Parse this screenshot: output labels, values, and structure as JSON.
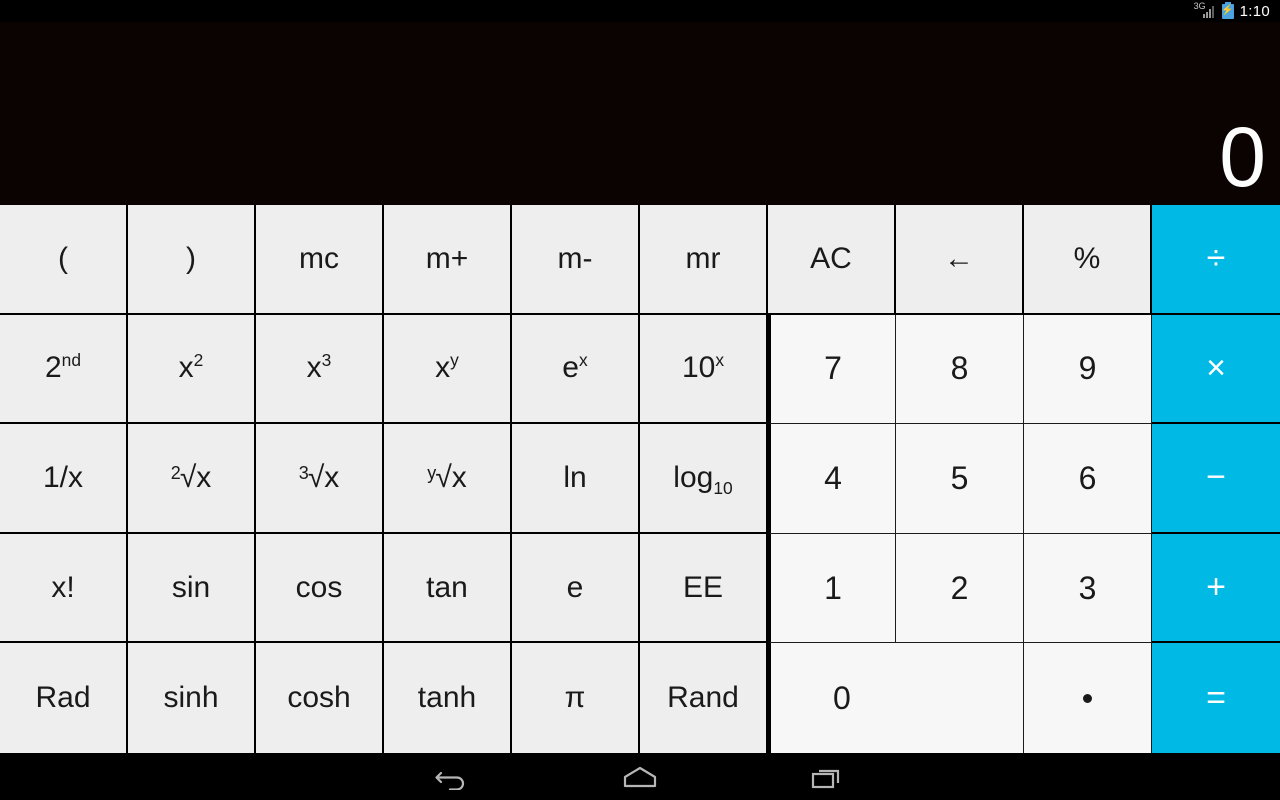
{
  "status_bar": {
    "network_label": "3G",
    "battery_icon": "battery-charging-icon",
    "signal_icon": "signal-bars-icon",
    "time": "1:10"
  },
  "display": {
    "value": "0"
  },
  "keypad": {
    "rows": [
      {
        "keys": [
          {
            "label": "(",
            "name": "key-open-paren",
            "kind": "fn"
          },
          {
            "label": ")",
            "name": "key-close-paren",
            "kind": "fn"
          },
          {
            "label": "mc",
            "name": "key-mc",
            "kind": "fn"
          },
          {
            "label": "m+",
            "name": "key-m-plus",
            "kind": "fn"
          },
          {
            "label": "m-",
            "name": "key-m-minus",
            "kind": "fn"
          },
          {
            "label": "mr",
            "name": "key-mr",
            "kind": "fn"
          },
          {
            "label": "AC",
            "name": "key-all-clear",
            "kind": "fn"
          },
          {
            "label": "←",
            "name": "key-backspace",
            "kind": "fn"
          },
          {
            "label": "%",
            "name": "key-percent",
            "kind": "fn"
          },
          {
            "label": "÷",
            "name": "key-divide",
            "kind": "op"
          }
        ]
      },
      {
        "keys": [
          {
            "label": "2nd",
            "name": "key-second",
            "kind": "fn"
          },
          {
            "label": "x2",
            "name": "key-x-squared",
            "kind": "fn"
          },
          {
            "label": "x3",
            "name": "key-x-cubed",
            "kind": "fn"
          },
          {
            "label": "xy",
            "name": "key-x-pow-y",
            "kind": "fn"
          },
          {
            "label": "ex",
            "name": "key-e-pow-x",
            "kind": "fn"
          },
          {
            "label": "10x",
            "name": "key-ten-pow-x",
            "kind": "fn"
          },
          {
            "label": "7",
            "name": "key-7",
            "kind": "num"
          },
          {
            "label": "8",
            "name": "key-8",
            "kind": "num"
          },
          {
            "label": "9",
            "name": "key-9",
            "kind": "num"
          },
          {
            "label": "×",
            "name": "key-multiply",
            "kind": "op"
          }
        ]
      },
      {
        "keys": [
          {
            "label": "1/x",
            "name": "key-reciprocal",
            "kind": "fn"
          },
          {
            "label": "2sqrtx",
            "name": "key-square-root",
            "kind": "fn"
          },
          {
            "label": "3sqrtx",
            "name": "key-cube-root",
            "kind": "fn"
          },
          {
            "label": "ysqrtx",
            "name": "key-y-root",
            "kind": "fn"
          },
          {
            "label": "ln",
            "name": "key-ln",
            "kind": "fn"
          },
          {
            "label": "log10",
            "name": "key-log-base-10",
            "kind": "fn"
          },
          {
            "label": "4",
            "name": "key-4",
            "kind": "num"
          },
          {
            "label": "5",
            "name": "key-5",
            "kind": "num"
          },
          {
            "label": "6",
            "name": "key-6",
            "kind": "num"
          },
          {
            "label": "−",
            "name": "key-subtract",
            "kind": "op"
          }
        ]
      },
      {
        "keys": [
          {
            "label": "x!",
            "name": "key-factorial",
            "kind": "fn"
          },
          {
            "label": "sin",
            "name": "key-sin",
            "kind": "fn"
          },
          {
            "label": "cos",
            "name": "key-cos",
            "kind": "fn"
          },
          {
            "label": "tan",
            "name": "key-tan",
            "kind": "fn"
          },
          {
            "label": "e",
            "name": "key-euler",
            "kind": "fn"
          },
          {
            "label": "EE",
            "name": "key-ee",
            "kind": "fn"
          },
          {
            "label": "1",
            "name": "key-1",
            "kind": "num"
          },
          {
            "label": "2",
            "name": "key-2",
            "kind": "num"
          },
          {
            "label": "3",
            "name": "key-3",
            "kind": "num"
          },
          {
            "label": "+",
            "name": "key-add",
            "kind": "op"
          }
        ]
      },
      {
        "keys": [
          {
            "label": "Rad",
            "name": "key-rad",
            "kind": "fn"
          },
          {
            "label": "sinh",
            "name": "key-sinh",
            "kind": "fn"
          },
          {
            "label": "cosh",
            "name": "key-cosh",
            "kind": "fn"
          },
          {
            "label": "tanh",
            "name": "key-tanh",
            "kind": "fn"
          },
          {
            "label": "π",
            "name": "key-pi",
            "kind": "fn"
          },
          {
            "label": "Rand",
            "name": "key-rand",
            "kind": "fn"
          },
          {
            "label": "0",
            "name": "key-0",
            "kind": "num-wide"
          },
          {
            "label": ".",
            "name": "key-decimal",
            "kind": "num"
          },
          {
            "label": "=",
            "name": "key-equals",
            "kind": "op"
          }
        ]
      }
    ]
  },
  "nav_bar": {
    "back_label": "back-icon",
    "home_label": "home-icon",
    "recents_label": "recents-icon"
  },
  "colors": {
    "operator": "#00b9e4",
    "function_key": "#eeeeee",
    "number_key": "#f7f7f7",
    "display_bg": "#0a0302",
    "key_text": "#1a1a1a"
  }
}
